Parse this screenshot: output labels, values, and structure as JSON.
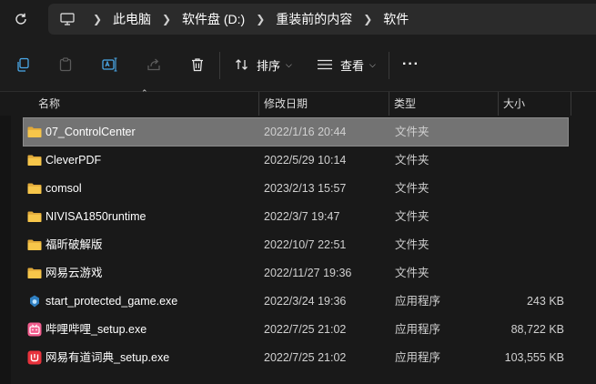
{
  "address_bar": {
    "breadcrumbs": [
      "此电脑",
      "软件盘 (D:)",
      "重装前的内容",
      "软件"
    ]
  },
  "toolbar": {
    "sort_label": "排序",
    "view_label": "查看",
    "more_label": "···"
  },
  "columns": {
    "name": "名称",
    "date": "修改日期",
    "type": "类型",
    "size": "大小"
  },
  "files": [
    {
      "name": "07_ControlCenter",
      "date": "2022/1/16 20:44",
      "type": "文件夹",
      "size": "",
      "icon": "folder-icon",
      "selected": true
    },
    {
      "name": "CleverPDF",
      "date": "2022/5/29 10:14",
      "type": "文件夹",
      "size": "",
      "icon": "folder-icon"
    },
    {
      "name": "comsol",
      "date": "2023/2/13 15:57",
      "type": "文件夹",
      "size": "",
      "icon": "folder-icon"
    },
    {
      "name": "NIVISA1850runtime",
      "date": "2022/3/7 19:47",
      "type": "文件夹",
      "size": "",
      "icon": "folder-icon"
    },
    {
      "name": "福昕破解版",
      "date": "2022/10/7 22:51",
      "type": "文件夹",
      "size": "",
      "icon": "folder-icon"
    },
    {
      "name": "网易云游戏",
      "date": "2022/11/27 19:36",
      "type": "文件夹",
      "size": "",
      "icon": "folder-icon"
    },
    {
      "name": "start_protected_game.exe",
      "date": "2022/3/24 19:36",
      "type": "应用程序",
      "size": "243 KB",
      "icon": "blue-app-icon"
    },
    {
      "name": "哔哩哔哩_setup.exe",
      "date": "2022/7/25 21:02",
      "type": "应用程序",
      "size": "88,722 KB",
      "icon": "bilibili-icon"
    },
    {
      "name": "网易有道词典_setup.exe",
      "date": "2022/7/25 21:02",
      "type": "应用程序",
      "size": "103,555 KB",
      "icon": "youdao-icon"
    }
  ],
  "colors": {
    "folder": "#f7c64a",
    "selected_row": "#737373",
    "bilibili": "#f25d8e",
    "youdao": "#e8323c"
  }
}
